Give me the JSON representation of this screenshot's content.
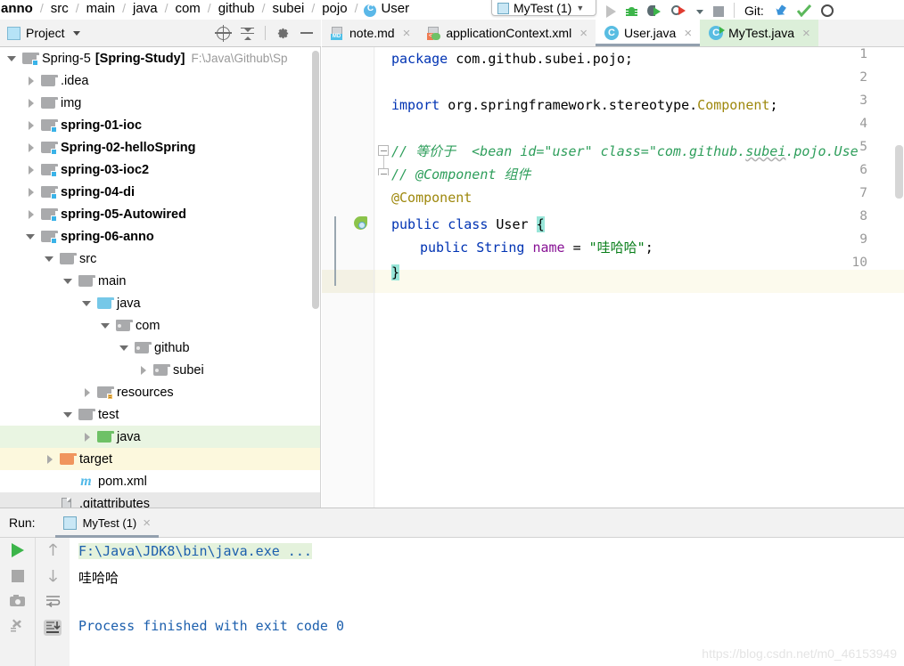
{
  "breadcrumb": {
    "items": [
      "anno",
      "src",
      "main",
      "java",
      "com",
      "github",
      "subei",
      "pojo",
      "User"
    ],
    "separator": "/"
  },
  "toolbar": {
    "run_config_label": "MyTest (1)",
    "git_label": "Git:",
    "icons": [
      "run-icon",
      "debug-icon",
      "run-with-debug-icon",
      "run-coverage-icon",
      "dropdown-icon",
      "stop-icon",
      "git-update-icon",
      "git-commit-icon",
      "search-icon"
    ]
  },
  "project_panel": {
    "title": "Project",
    "tools": [
      "locate-target-icon",
      "collapse-all-icon",
      "settings-gear-icon",
      "hide-panel-icon"
    ],
    "tree": [
      {
        "label": "Spring-5",
        "label2": "[Spring-Study]",
        "path": "F:\\Java\\Github\\Sp",
        "indent": 0,
        "arrow": "down",
        "icon": "module-folder",
        "bold": false,
        "highlight": "none"
      },
      {
        "label": ".idea",
        "indent": 1,
        "arrow": "right",
        "icon": "folder-gray",
        "bold": false,
        "highlight": "none"
      },
      {
        "label": "img",
        "indent": 1,
        "arrow": "right",
        "icon": "folder-gray",
        "bold": false,
        "highlight": "none"
      },
      {
        "label": "spring-01-ioc",
        "indent": 1,
        "arrow": "right",
        "icon": "module-folder",
        "bold": true,
        "highlight": "none"
      },
      {
        "label": "Spring-02-helloSpring",
        "indent": 1,
        "arrow": "right",
        "icon": "module-folder",
        "bold": true,
        "highlight": "none"
      },
      {
        "label": "spring-03-ioc2",
        "indent": 1,
        "arrow": "right",
        "icon": "module-folder",
        "bold": true,
        "highlight": "none"
      },
      {
        "label": "spring-04-di",
        "indent": 1,
        "arrow": "right",
        "icon": "module-folder",
        "bold": true,
        "highlight": "none"
      },
      {
        "label": "spring-05-Autowired",
        "indent": 1,
        "arrow": "right",
        "icon": "module-folder",
        "bold": true,
        "highlight": "none"
      },
      {
        "label": "spring-06-anno",
        "indent": 1,
        "arrow": "down",
        "icon": "module-folder",
        "bold": true,
        "highlight": "none"
      },
      {
        "label": "src",
        "indent": 2,
        "arrow": "down",
        "icon": "folder-gray",
        "bold": false,
        "highlight": "none"
      },
      {
        "label": "main",
        "indent": 3,
        "arrow": "down",
        "icon": "folder-gray",
        "bold": false,
        "highlight": "none"
      },
      {
        "label": "java",
        "indent": 4,
        "arrow": "down",
        "icon": "folder-blue",
        "bold": false,
        "highlight": "none"
      },
      {
        "label": "com",
        "indent": 5,
        "arrow": "down",
        "icon": "package-gray",
        "bold": false,
        "highlight": "none"
      },
      {
        "label": "github",
        "indent": 6,
        "arrow": "down",
        "icon": "package-gray",
        "bold": false,
        "highlight": "none"
      },
      {
        "label": "subei",
        "indent": 7,
        "arrow": "right",
        "icon": "package-gray",
        "bold": false,
        "highlight": "none"
      },
      {
        "label": "resources",
        "indent": 4,
        "arrow": "right",
        "icon": "resources-folder",
        "bold": false,
        "highlight": "none"
      },
      {
        "label": "test",
        "indent": 3,
        "arrow": "down",
        "icon": "folder-gray",
        "bold": false,
        "highlight": "none"
      },
      {
        "label": "java",
        "indent": 4,
        "arrow": "right",
        "icon": "folder-green",
        "bold": false,
        "highlight": "green"
      },
      {
        "label": "target",
        "indent": 2,
        "arrow": "right",
        "icon": "folder-orange",
        "bold": false,
        "highlight": "yellow"
      },
      {
        "label": "pom.xml",
        "indent": 3,
        "arrow": "none",
        "icon": "maven-icon",
        "bold": false,
        "highlight": "none"
      },
      {
        "label": ".gitattributes",
        "indent": 2,
        "arrow": "none",
        "icon": "file-gray",
        "bold": false,
        "highlight": "gray"
      }
    ]
  },
  "editor": {
    "tabs": [
      {
        "label": "note.md",
        "icon": "markdown-file-icon",
        "state": "inactive"
      },
      {
        "label": "applicationContext.xml",
        "icon": "xml-spring-file-icon",
        "state": "inactive"
      },
      {
        "label": "User.java",
        "icon": "java-class-icon",
        "state": "active"
      },
      {
        "label": "MyTest.java",
        "icon": "java-runnable-class-icon",
        "state": "active-green"
      }
    ],
    "close_glyph": "×",
    "line_numbers": [
      "1",
      "2",
      "3",
      "4",
      "5",
      "6",
      "7",
      "8",
      "9",
      "10"
    ],
    "current_line": 10,
    "code": {
      "l1_kw": "package",
      "l1_rest": " com.github.subei.pojo;",
      "l3_kw": "import",
      "l3_rest": " org.springframework.stereotype.",
      "l3_type": "Component",
      "l3_semi": ";",
      "l5_comment": "// 等价于  <bean id=\"user\" class=\"com.github.",
      "l5_comment_squig": "subei",
      "l5_comment_tail": ".pojo.Use",
      "l6_comment": "// @Component 组件",
      "l7_anno": "@Component",
      "l8_kw1": "public",
      "l8_kw2": "class",
      "l8_name": " User ",
      "l8_brace": "{",
      "l9_kw1": "public",
      "l9_type": " String ",
      "l9_field": "name",
      "l9_eq": " = ",
      "l9_str": "\"哇哈哈\"",
      "l9_semi": ";",
      "l10_brace": "}"
    }
  },
  "run_panel": {
    "label": "Run:",
    "tab_label": "MyTest (1)",
    "close_glyph": "×",
    "tool_icons": [
      "rerun-icon",
      "stop-icon",
      "screenshot-icon",
      "debug-threads-icon",
      "scroll-up-icon",
      "scroll-down-icon",
      "soft-wrap-icon",
      "scroll-to-end-icon"
    ],
    "console": [
      {
        "text": "F:\\Java\\JDK8\\bin\\java.exe ...",
        "type": "command"
      },
      {
        "text": "哇哈哈",
        "type": "output"
      },
      {
        "text": "Process finished with exit code 0",
        "type": "finished"
      }
    ]
  },
  "watermark": "https://blog.csdn.net/m0_46153949",
  "colors": {
    "accent_blue": "#0033b3",
    "string_green": "#067d17",
    "comment_green": "#2e9e5b",
    "annotation_gold": "#9e880d",
    "field_purple": "#871094",
    "tab_green": "#dcefd9",
    "tree_green_hl": "#e9f5e2",
    "tree_yellow_hl": "#fcf8dd"
  }
}
